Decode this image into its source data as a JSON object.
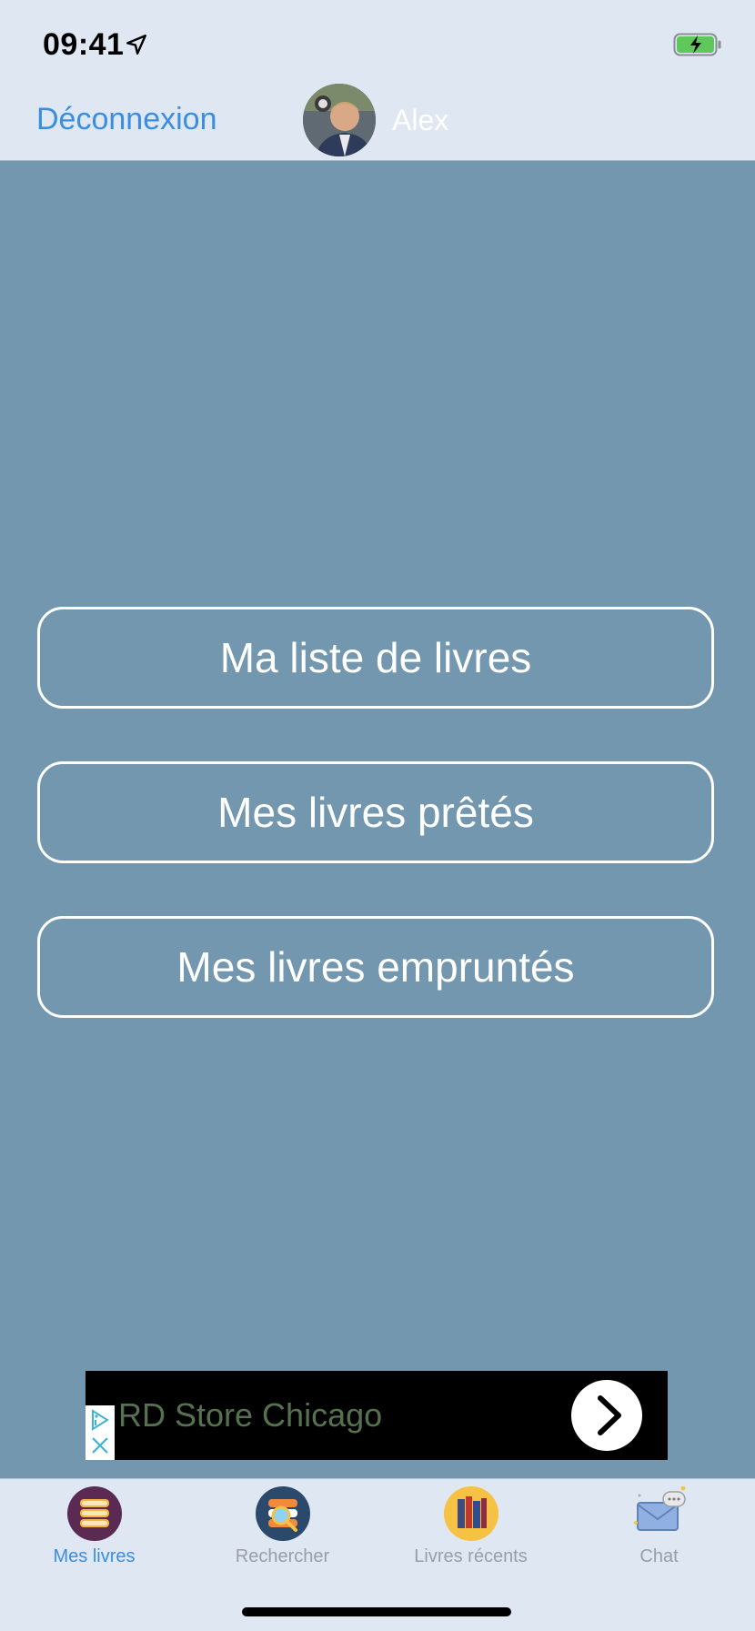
{
  "status": {
    "time": "09:41"
  },
  "header": {
    "logout_label": "Déconnexion",
    "username": "Alex"
  },
  "buttons": {
    "my_list": "Ma liste de livres",
    "lent": "Mes livres prêtés",
    "borrowed": "Mes livres empruntés"
  },
  "ad": {
    "text": "RD Store Chicago"
  },
  "tabs": [
    {
      "label": "Mes livres",
      "icon": "books-stack-icon"
    },
    {
      "label": "Rechercher",
      "icon": "search-book-icon"
    },
    {
      "label": "Livres récents",
      "icon": "bookshelf-icon"
    },
    {
      "label": "Chat",
      "icon": "envelope-chat-icon"
    }
  ],
  "colors": {
    "accent": "#3b8de0",
    "background": "#7297ae",
    "bar": "#dfe7f2"
  }
}
